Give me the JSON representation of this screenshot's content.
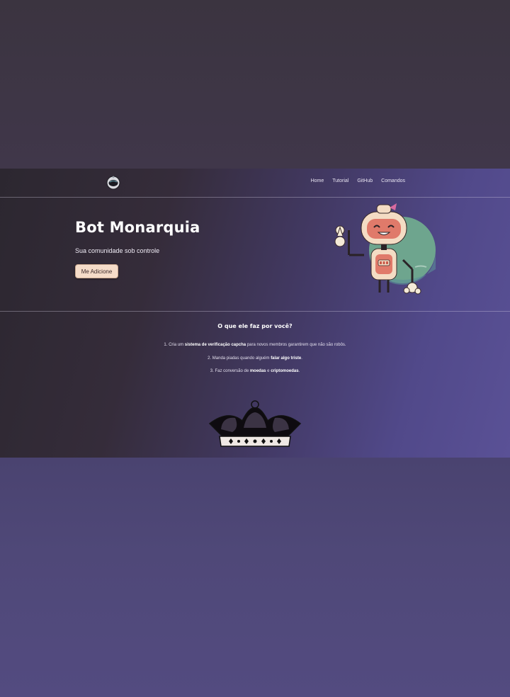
{
  "navbar": {
    "logo_icon": "astronaut-helmet-icon",
    "links": [
      "Home",
      "Tutorial",
      "GitHub",
      "Comandos"
    ]
  },
  "hero": {
    "title": "Bot Monarquia",
    "subtitle": "Sua comunidade sob controle",
    "button_label": "Me Adicione",
    "illustration": "waving-robot-illustration"
  },
  "features": {
    "title": "O que ele faz por você?",
    "items": [
      {
        "prefix": "1. Cria um ",
        "highlight": "sistema de verificação capcha",
        "suffix": " para novos membros garantirem que não são robôs."
      },
      {
        "prefix": "2. Manda piadas quando alguém ",
        "highlight": "falar algo triste",
        "suffix": "."
      },
      {
        "prefix": "3. Faz conversão de ",
        "highlight": "moedas",
        "middle": " e ",
        "highlight2": "criptomoedas",
        "suffix": "."
      }
    ],
    "illustration": "crown-icon"
  },
  "colors": {
    "button_bg": "#f5dcc9",
    "gradient_dark": "#2c2730",
    "gradient_purple": "#5a5196",
    "robot_pink": "#e07a6a",
    "robot_cream": "#f4dcc4"
  }
}
